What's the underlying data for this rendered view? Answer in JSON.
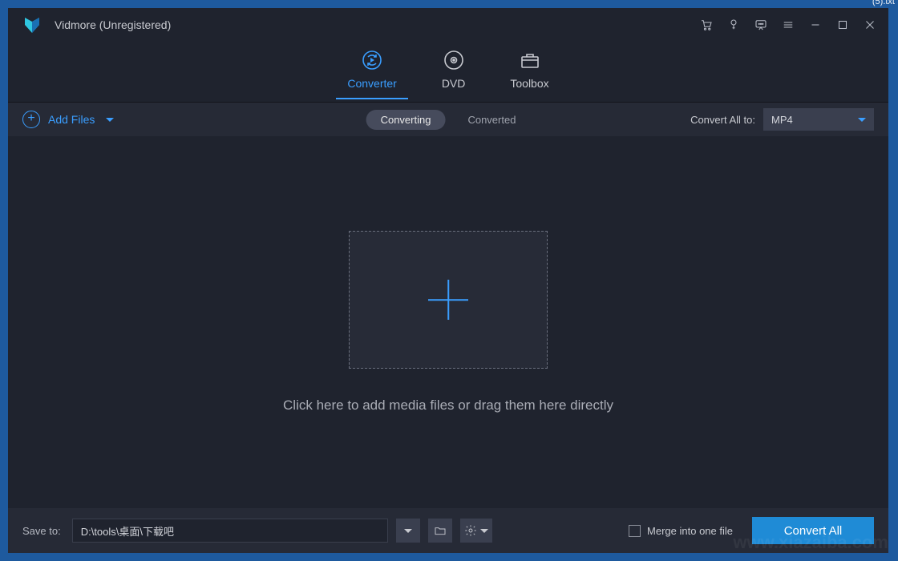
{
  "desktop": {
    "file_tag": "(5).txt"
  },
  "titlebar": {
    "title": "Vidmore (Unregistered)"
  },
  "mainTabs": {
    "converter": "Converter",
    "dvd": "DVD",
    "toolbox": "Toolbox"
  },
  "subbar": {
    "addFiles": "Add Files",
    "converting": "Converting",
    "converted": "Converted",
    "convertAllTo": "Convert All to:",
    "format": "MP4"
  },
  "content": {
    "dropText": "Click here to add media files or drag them here directly"
  },
  "bottombar": {
    "saveTo": "Save to:",
    "path": "D:\\tools\\桌面\\下载吧",
    "merge": "Merge into one file",
    "convertAll": "Convert All"
  },
  "watermark": "www.xiazaiba.com"
}
